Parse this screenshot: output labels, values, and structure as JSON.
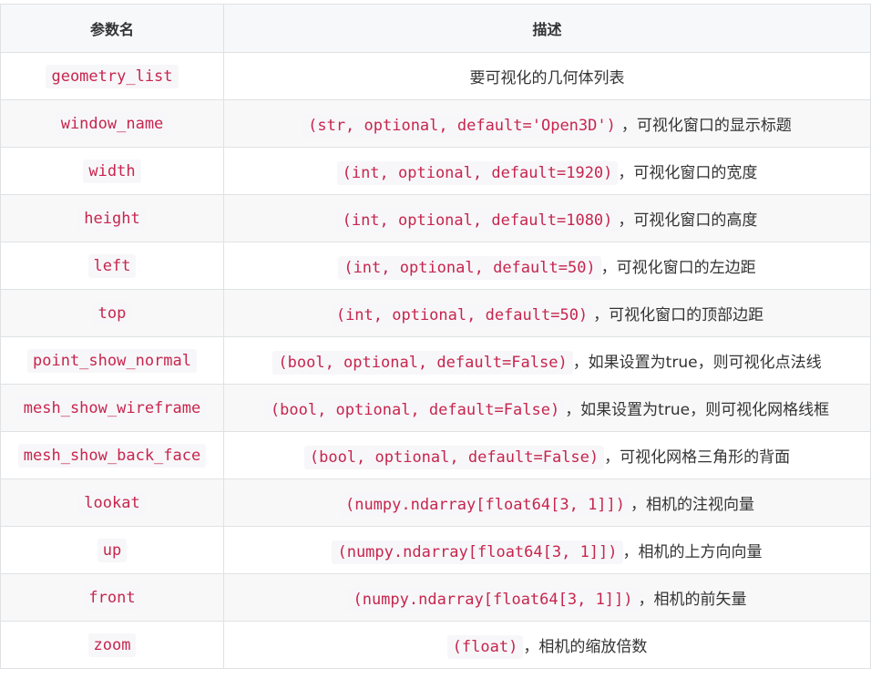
{
  "table": {
    "headers": [
      "参数名",
      "描述"
    ],
    "rows": [
      {
        "name": "geometry_list",
        "code": "",
        "text": "要可视化的几何体列表"
      },
      {
        "name": "window_name",
        "code": "(str, optional, default='Open3D')",
        "text": "，可视化窗口的显示标题"
      },
      {
        "name": "width",
        "code": "(int, optional, default=1920)",
        "text": "，可视化窗口的宽度"
      },
      {
        "name": "height",
        "code": "(int, optional, default=1080)",
        "text": "，可视化窗口的高度"
      },
      {
        "name": "left",
        "code": "(int, optional, default=50)",
        "text": "，可视化窗口的左边距"
      },
      {
        "name": "top",
        "code": "(int, optional, default=50)",
        "text": "，可视化窗口的顶部边距"
      },
      {
        "name": "point_show_normal",
        "code": "(bool, optional, default=False)",
        "text": "，如果设置为true，则可视化点法线"
      },
      {
        "name": "mesh_show_wireframe",
        "code": "(bool, optional, default=False)",
        "text": "，如果设置为true，则可视化网格线框"
      },
      {
        "name": "mesh_show_back_face",
        "code": "(bool, optional, default=False)",
        "text": "，可视化网格三角形的背面"
      },
      {
        "name": "lookat",
        "code": "(numpy.ndarray[float64[3, 1]])",
        "text": "，相机的注视向量"
      },
      {
        "name": "up",
        "code": "(numpy.ndarray[float64[3, 1]])",
        "text": "，相机的上方向向量"
      },
      {
        "name": "front",
        "code": "(numpy.ndarray[float64[3, 1]])",
        "text": "，相机的前矢量"
      },
      {
        "name": "zoom",
        "code": "(float)",
        "text": "，相机的缩放倍数"
      }
    ]
  },
  "colors": {
    "code_text": "#c7254e",
    "code_background": "#f7f7f9",
    "header_background": "#f6f8fa",
    "stripe_background": "#f8f8f8",
    "border": "#dfe2e5"
  }
}
